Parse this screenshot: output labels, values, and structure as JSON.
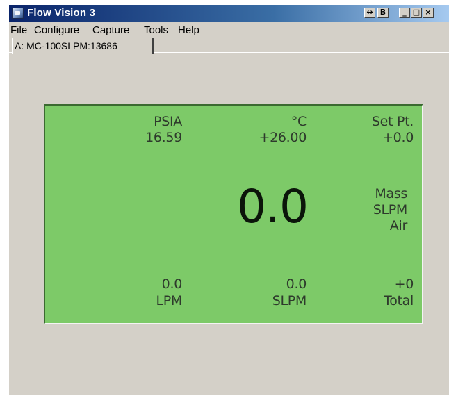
{
  "window": {
    "title": "Flow Vision 3",
    "buttons": {
      "pin": "↔",
      "restore_child": "B",
      "minimize": "_",
      "maximize": "□",
      "close": "×"
    }
  },
  "menu": [
    "File",
    "Configure",
    "Capture",
    "Tools",
    "Help"
  ],
  "tab": {
    "label": "A: MC-100SLPM:13686"
  },
  "display": {
    "background_color": "#7dca68",
    "pressure": {
      "unit": "PSIA",
      "value": "16.59"
    },
    "temperature": {
      "unit": "°C",
      "value": "+26.00"
    },
    "setpoint": {
      "label": "Set Pt.",
      "value": "+0.0"
    },
    "main_reading": "0.0",
    "mode": {
      "line1": "Mass",
      "line2": "SLPM",
      "line3": "Air"
    },
    "volumetric": {
      "value": "0.0",
      "unit": "LPM"
    },
    "standard": {
      "value": "0.0",
      "unit": "SLPM"
    },
    "total": {
      "value": "+0",
      "label": "Total"
    }
  }
}
